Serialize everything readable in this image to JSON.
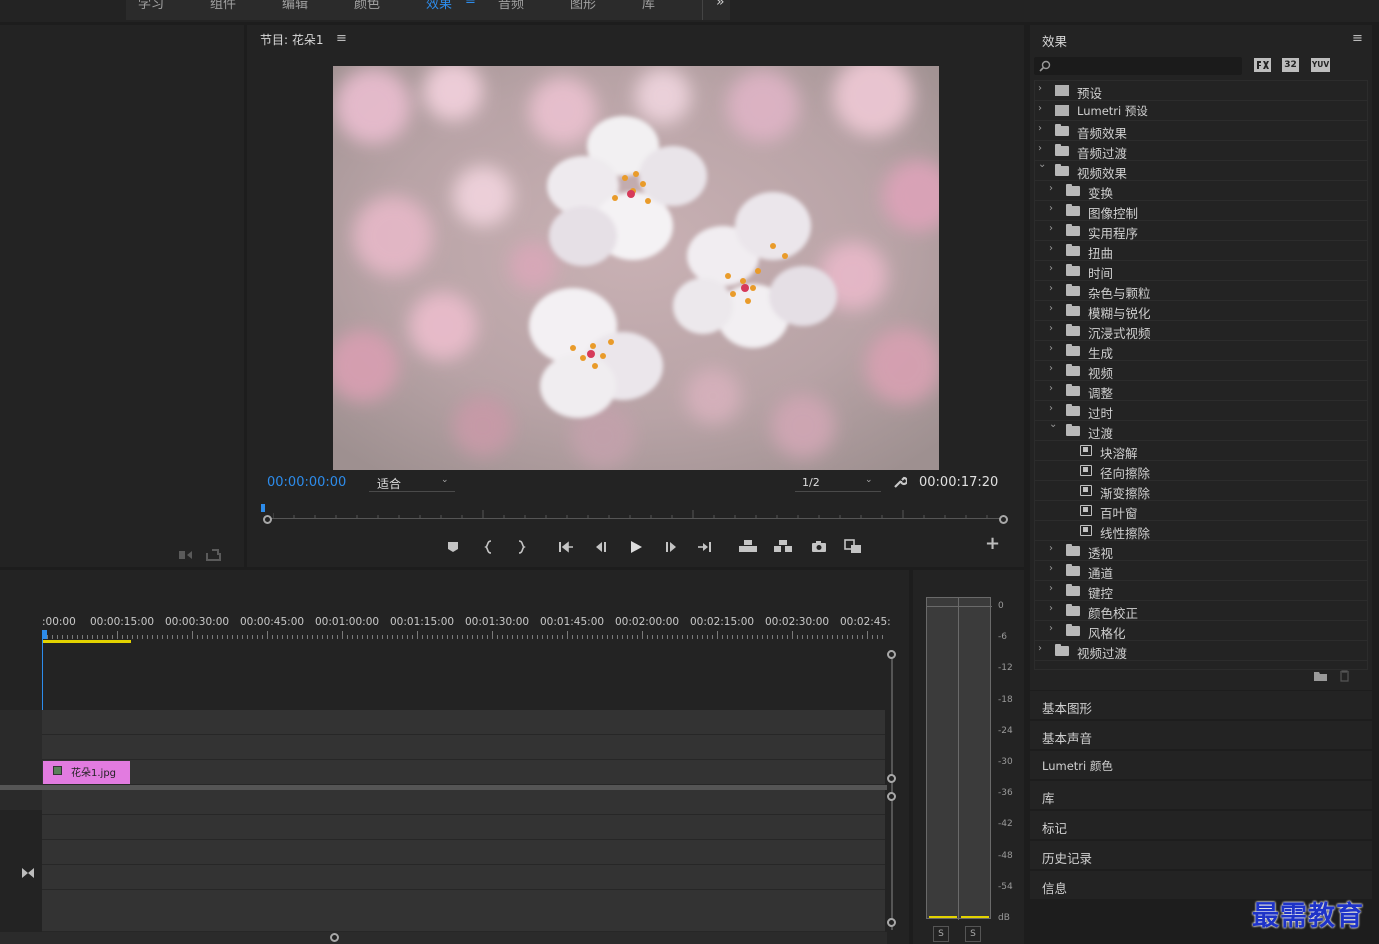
{
  "workspaces": {
    "tabs": [
      {
        "label": "学习"
      },
      {
        "label": "组件"
      },
      {
        "label": "编辑"
      },
      {
        "label": "颜色"
      },
      {
        "label": "效果"
      },
      {
        "label": "音频"
      },
      {
        "label": "图形"
      },
      {
        "label": "库"
      }
    ],
    "menu_glyph": "≡",
    "more_glyph": "»"
  },
  "program_monitor": {
    "title": "节目: 花朵1",
    "menu_glyph": "≡",
    "timecode_current": "00:00:00:00",
    "fit_label": "适合",
    "resolution_label": "1/2",
    "timecode_duration": "00:00:17:20",
    "add_button_glyph": "+"
  },
  "effects": {
    "title": "效果",
    "menu_glyph": "≡",
    "search_placeholder": "",
    "accel_badges": [
      "32",
      "YUV"
    ],
    "items": [
      {
        "label": "预设",
        "level": 0,
        "expanded": false,
        "type": "preset"
      },
      {
        "label": "Lumetri 预设",
        "level": 0,
        "expanded": false,
        "type": "preset"
      },
      {
        "label": "音频效果",
        "level": 0,
        "expanded": false,
        "type": "folder"
      },
      {
        "label": "音频过渡",
        "level": 0,
        "expanded": false,
        "type": "folder"
      },
      {
        "label": "视频效果",
        "level": 0,
        "expanded": true,
        "type": "folder"
      },
      {
        "label": "变换",
        "level": 1,
        "expanded": false,
        "type": "folder"
      },
      {
        "label": "图像控制",
        "level": 1,
        "expanded": false,
        "type": "folder"
      },
      {
        "label": "实用程序",
        "level": 1,
        "expanded": false,
        "type": "folder"
      },
      {
        "label": "扭曲",
        "level": 1,
        "expanded": false,
        "type": "folder"
      },
      {
        "label": "时间",
        "level": 1,
        "expanded": false,
        "type": "folder"
      },
      {
        "label": "杂色与颗粒",
        "level": 1,
        "expanded": false,
        "type": "folder"
      },
      {
        "label": "模糊与锐化",
        "level": 1,
        "expanded": false,
        "type": "folder"
      },
      {
        "label": "沉浸式视频",
        "level": 1,
        "expanded": false,
        "type": "folder"
      },
      {
        "label": "生成",
        "level": 1,
        "expanded": false,
        "type": "folder"
      },
      {
        "label": "视频",
        "level": 1,
        "expanded": false,
        "type": "folder"
      },
      {
        "label": "调整",
        "level": 1,
        "expanded": false,
        "type": "folder"
      },
      {
        "label": "过时",
        "level": 1,
        "expanded": false,
        "type": "folder"
      },
      {
        "label": "过渡",
        "level": 1,
        "expanded": true,
        "type": "folder"
      },
      {
        "label": "块溶解",
        "level": 2,
        "expanded": false,
        "type": "effect"
      },
      {
        "label": "径向擦除",
        "level": 2,
        "expanded": false,
        "type": "effect"
      },
      {
        "label": "渐变擦除",
        "level": 2,
        "expanded": false,
        "type": "effect"
      },
      {
        "label": "百叶窗",
        "level": 2,
        "expanded": false,
        "type": "effect"
      },
      {
        "label": "线性擦除",
        "level": 2,
        "expanded": false,
        "type": "effect"
      },
      {
        "label": "透视",
        "level": 1,
        "expanded": false,
        "type": "folder"
      },
      {
        "label": "通道",
        "level": 1,
        "expanded": false,
        "type": "folder"
      },
      {
        "label": "键控",
        "level": 1,
        "expanded": false,
        "type": "folder"
      },
      {
        "label": "颜色校正",
        "level": 1,
        "expanded": false,
        "type": "folder"
      },
      {
        "label": "风格化",
        "level": 1,
        "expanded": false,
        "type": "folder"
      },
      {
        "label": "视频过渡",
        "level": 0,
        "expanded": false,
        "type": "folder"
      }
    ]
  },
  "side_panels": [
    {
      "label": "基本图形"
    },
    {
      "label": "基本声音"
    },
    {
      "label": "Lumetri 颜色"
    },
    {
      "label": "库"
    },
    {
      "label": "标记"
    },
    {
      "label": "历史记录"
    },
    {
      "label": "信息"
    }
  ],
  "timeline": {
    "ruler_labels": [
      ":00:00",
      "00:00:15:00",
      "00:00:30:00",
      "00:00:45:00",
      "00:01:00:00",
      "00:01:15:00",
      "00:01:30:00",
      "00:01:45:00",
      "00:02:00:00",
      "00:02:15:00",
      "00:02:30:00",
      "00:02:45:"
    ],
    "clip": {
      "label": "花朵1.jpg",
      "color": "#e27be0"
    }
  },
  "audio_meter": {
    "scale": [
      "0",
      "-6",
      "-12",
      "-18",
      "-24",
      "-30",
      "-36",
      "-42",
      "-48",
      "-54",
      "dB"
    ],
    "solo_buttons": [
      "S",
      "S"
    ]
  },
  "watermark": {
    "text": "最需教育",
    "color": "#1e33c8"
  },
  "colors": {
    "accent": "#2d8ceb",
    "clip": "#e27be0",
    "in_out_bar": "#e3d300"
  }
}
